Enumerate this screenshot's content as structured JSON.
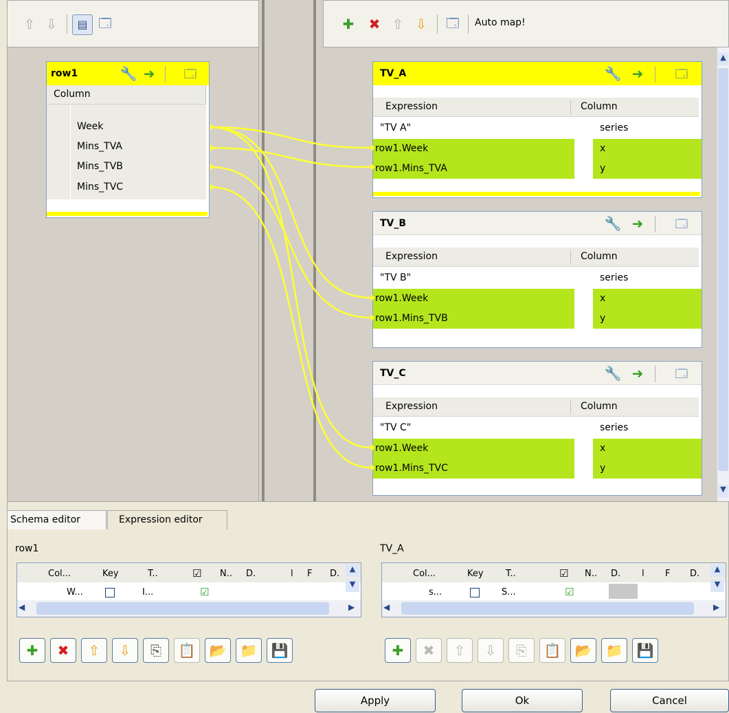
{
  "left_toolbar": {
    "icons": [
      "up-arrow-icon",
      "down-arrow-icon",
      "table-icon",
      "window-icon"
    ]
  },
  "right_toolbar": {
    "auto_map_label": "Auto map!"
  },
  "input_table": {
    "title": "row1",
    "column_header": "Column",
    "rows": [
      "Week",
      "Mins_TVA",
      "Mins_TVB",
      "Mins_TVC"
    ]
  },
  "output_tables": [
    {
      "title": "TV_A",
      "expr_header": "Expression",
      "col_header": "Column",
      "rows": [
        {
          "expr": "\"TV A\"",
          "col": "series",
          "mapped": false
        },
        {
          "expr": "row1.Week",
          "col": "x",
          "mapped": true
        },
        {
          "expr": "row1.Mins_TVA",
          "col": "y",
          "mapped": true
        }
      ]
    },
    {
      "title": "TV_B",
      "expr_header": "Expression",
      "col_header": "Column",
      "rows": [
        {
          "expr": "\"TV B\"",
          "col": "series",
          "mapped": false
        },
        {
          "expr": "row1.Week",
          "col": "x",
          "mapped": true
        },
        {
          "expr": "row1.Mins_TVB",
          "col": "y",
          "mapped": true
        }
      ]
    },
    {
      "title": "TV_C",
      "expr_header": "Expression",
      "col_header": "Column",
      "rows": [
        {
          "expr": "\"TV C\"",
          "col": "series",
          "mapped": false
        },
        {
          "expr": "row1.Week",
          "col": "x",
          "mapped": true
        },
        {
          "expr": "row1.Mins_TVC",
          "col": "y",
          "mapped": true
        }
      ]
    }
  ],
  "tabs": {
    "schema_editor": "Schema editor",
    "expression_editor": "Expression editor"
  },
  "schema_left": {
    "title": "row1",
    "headers": [
      "Col...",
      "Key",
      "T..",
      "N..",
      "D.",
      "l",
      "F",
      "D."
    ],
    "row": [
      "W...",
      "I..."
    ]
  },
  "schema_right": {
    "title": "TV_A",
    "headers": [
      "Col...",
      "Key",
      "T..",
      "N..",
      "D.",
      "l",
      "F",
      "D."
    ],
    "row": [
      "s...",
      "S..."
    ]
  },
  "buttons": {
    "apply": "Apply",
    "ok": "Ok",
    "cancel": "Cancel"
  },
  "colors": {
    "highlight_yellow": "#ffff00",
    "mapped_green": "#b5e61d",
    "link_yellow": "#ffff33"
  }
}
